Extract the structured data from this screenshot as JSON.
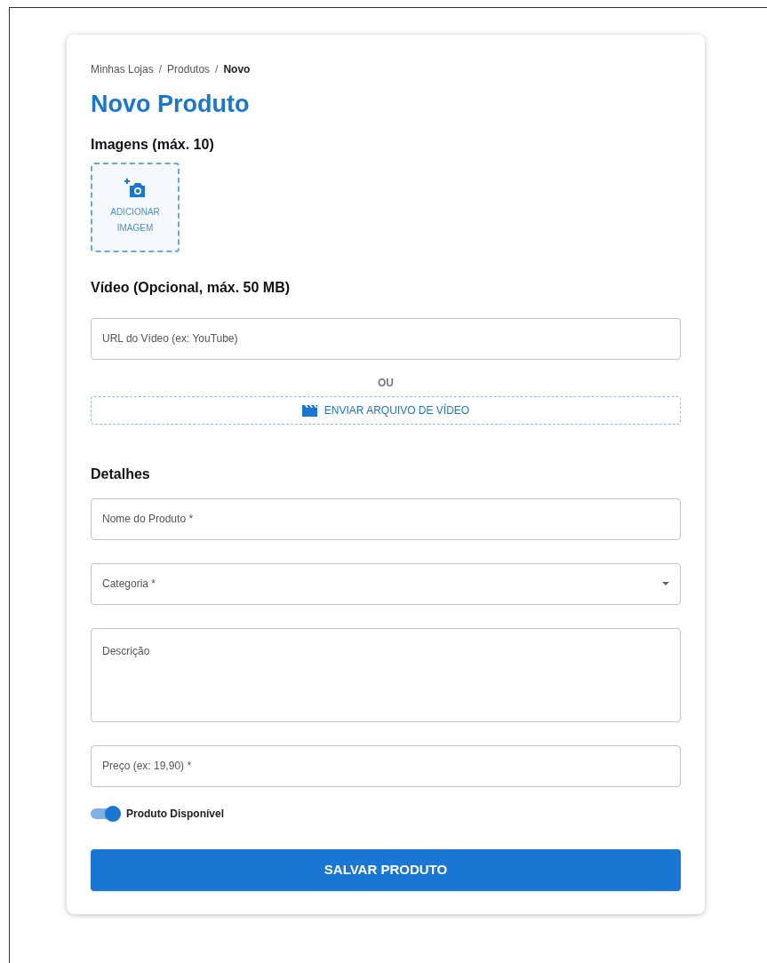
{
  "breadcrumb": [
    {
      "label": "Minhas Lojas",
      "current": false
    },
    {
      "label": "Produtos",
      "current": false
    },
    {
      "label": "Novo",
      "current": true
    }
  ],
  "breadcrumb_separator": "/",
  "title": "Novo Produto",
  "images_section": {
    "heading": "Imagens (máx. 10)",
    "add_button": [
      "ADICIONAR",
      "IMAGEM"
    ]
  },
  "video_section": {
    "heading": "Vídeo (Opcional, máx. 50 MB)",
    "url_field": {
      "placeholder": "URL do Vídeo (ex: YouTube)"
    },
    "divider": "OU",
    "upload_button": "ENVIAR ARQUIVO DE VÍDEO"
  },
  "details_section": {
    "heading": "Detalhes",
    "fields": [
      {
        "kind": "text",
        "placeholder": "Nome do Produto *"
      },
      {
        "kind": "select",
        "placeholder": "Categoria *"
      },
      {
        "kind": "textarea",
        "placeholder": "Descrição"
      },
      {
        "kind": "text",
        "placeholder": "Preço (ex: 19,90) *"
      }
    ]
  },
  "available_switch": {
    "label": "Produto Disponível",
    "on": true
  },
  "save_button": "SALVAR PRODUTO"
}
